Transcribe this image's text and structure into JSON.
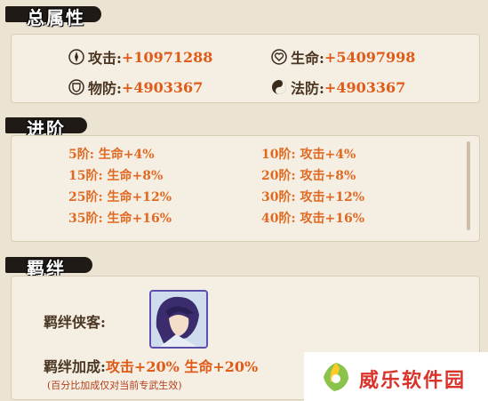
{
  "total": {
    "title": "总属性",
    "attack_label": "攻击:",
    "attack_value": "+10971288",
    "hp_label": "生命:",
    "hp_value": "+54097998",
    "pdef_label": "物防:",
    "pdef_value": "+4903367",
    "mdef_label": "法防:",
    "mdef_value": "+4903367"
  },
  "advance": {
    "title": "进阶",
    "tiers": [
      {
        "left": "5阶: 生命+4%",
        "right": "10阶: 攻击+4%"
      },
      {
        "left": "15阶: 生命+8%",
        "right": "20阶: 攻击+8%"
      },
      {
        "left": "25阶: 生命+12%",
        "right": "30阶: 攻击+12%"
      },
      {
        "left": "35阶: 生命+16%",
        "right": "40阶: 攻击+16%"
      }
    ]
  },
  "bond": {
    "title": "羁绊",
    "companion_label": "羁绊侠客:",
    "bonus_label": "羁绊加成:",
    "bonus_value": "攻击+20% 生命+20%",
    "note": "(百分比加成仅对当前专武生效)"
  },
  "watermark": {
    "text": "威乐软件园"
  },
  "colors": {
    "value": "#e05a18",
    "tier": "#e06a22",
    "brush": "#1f1a16"
  },
  "icons": [
    "sword-icon",
    "heart-icon",
    "shield-icon",
    "taiji-icon",
    "hero-portrait"
  ]
}
